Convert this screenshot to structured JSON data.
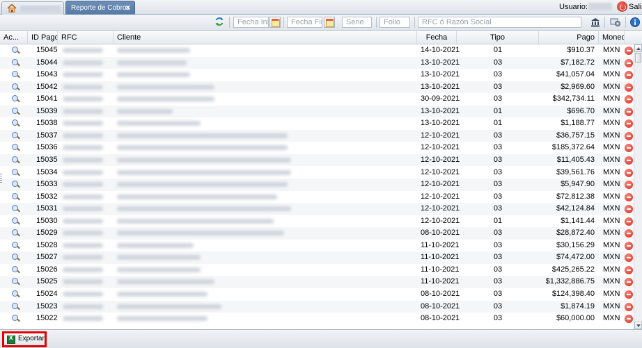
{
  "header": {
    "active_tab": "Reporte de Cobros",
    "close_glyph": "×",
    "user_label": "Usuario:",
    "logout_label": "Sali"
  },
  "filters": {
    "fecha_ini": "Fecha Ini",
    "fecha_fin": "Fecha Fin",
    "serie": "Serie",
    "folio": "Folio",
    "rfc": "RFC ó Razón Social"
  },
  "columns": {
    "acciones": "Ac...",
    "id_pago": "ID Pago",
    "rfc": "RFC",
    "cliente": "Cliente",
    "fecha": "Fecha",
    "tipo": "Tipo",
    "pago": "Pago",
    "moneda": "Moneda"
  },
  "rows": [
    {
      "id": "15045",
      "fecha": "14-10-2021",
      "tipo": "01",
      "pago": "$910.37",
      "moneda": "MXN"
    },
    {
      "id": "15044",
      "fecha": "13-10-2021",
      "tipo": "03",
      "pago": "$7,182.72",
      "moneda": "MXN"
    },
    {
      "id": "15043",
      "fecha": "13-10-2021",
      "tipo": "03",
      "pago": "$41,057.04",
      "moneda": "MXN"
    },
    {
      "id": "15042",
      "fecha": "13-10-2021",
      "tipo": "03",
      "pago": "$2,969.60",
      "moneda": "MXN"
    },
    {
      "id": "15041",
      "fecha": "30-09-2021",
      "tipo": "03",
      "pago": "$342,734.11",
      "moneda": "MXN"
    },
    {
      "id": "15039",
      "fecha": "13-10-2021",
      "tipo": "01",
      "pago": "$696.70",
      "moneda": "MXN"
    },
    {
      "id": "15038",
      "fecha": "13-10-2021",
      "tipo": "01",
      "pago": "$1,188.77",
      "moneda": "MXN"
    },
    {
      "id": "15037",
      "fecha": "12-10-2021",
      "tipo": "03",
      "pago": "$36,757.15",
      "moneda": "MXN"
    },
    {
      "id": "15036",
      "fecha": "12-10-2021",
      "tipo": "03",
      "pago": "$185,372.64",
      "moneda": "MXN"
    },
    {
      "id": "15035",
      "fecha": "12-10-2021",
      "tipo": "03",
      "pago": "$11,405.43",
      "moneda": "MXN"
    },
    {
      "id": "15034",
      "fecha": "12-10-2021",
      "tipo": "03",
      "pago": "$39,561.76",
      "moneda": "MXN"
    },
    {
      "id": "15033",
      "fecha": "12-10-2021",
      "tipo": "03",
      "pago": "$5,947.90",
      "moneda": "MXN"
    },
    {
      "id": "15032",
      "fecha": "12-10-2021",
      "tipo": "03",
      "pago": "$72,812.38",
      "moneda": "MXN"
    },
    {
      "id": "15031",
      "fecha": "12-10-2021",
      "tipo": "03",
      "pago": "$42,124.84",
      "moneda": "MXN"
    },
    {
      "id": "15030",
      "fecha": "12-10-2021",
      "tipo": "01",
      "pago": "$1,141.44",
      "moneda": "MXN"
    },
    {
      "id": "15029",
      "fecha": "08-10-2021",
      "tipo": "03",
      "pago": "$28,872.40",
      "moneda": "MXN"
    },
    {
      "id": "15028",
      "fecha": "11-10-2021",
      "tipo": "03",
      "pago": "$30,156.29",
      "moneda": "MXN"
    },
    {
      "id": "15027",
      "fecha": "11-10-2021",
      "tipo": "03",
      "pago": "$74,472.00",
      "moneda": "MXN"
    },
    {
      "id": "15026",
      "fecha": "11-10-2021",
      "tipo": "03",
      "pago": "$425,265.22",
      "moneda": "MXN"
    },
    {
      "id": "15025",
      "fecha": "11-10-2021",
      "tipo": "03",
      "pago": "$1,332,886.75",
      "moneda": "MXN"
    },
    {
      "id": "15024",
      "fecha": "08-10-2021",
      "tipo": "03",
      "pago": "$124,398.40",
      "moneda": "MXN"
    },
    {
      "id": "15023",
      "fecha": "08-10-2021",
      "tipo": "03",
      "pago": "$1,874.19",
      "moneda": "MXN"
    },
    {
      "id": "15022",
      "fecha": "08-10-2021",
      "tipo": "03",
      "pago": "$60,000.00",
      "moneda": "MXN"
    }
  ],
  "footer": {
    "export_label": "Exportar"
  },
  "icons": {
    "view": "magnifier-icon",
    "delete": "delete-icon",
    "export": "excel-icon"
  },
  "colors": {
    "active_tab": "#5b7fab",
    "delete": "#d6261a",
    "highlight": "#e00000"
  }
}
